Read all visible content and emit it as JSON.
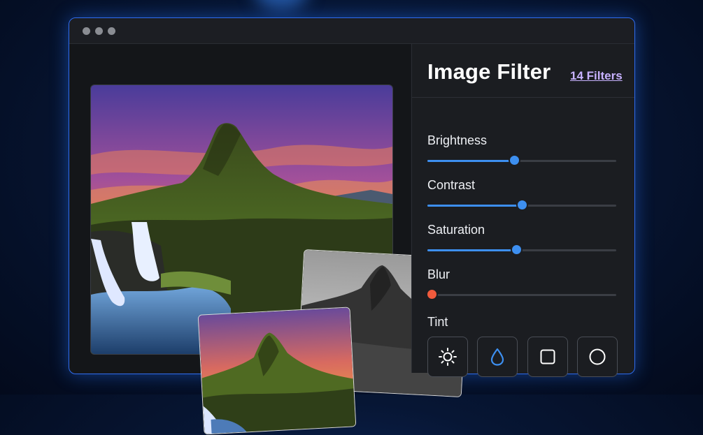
{
  "panel": {
    "title": "Image Filter",
    "filters_link": "14 Filters"
  },
  "sliders": [
    {
      "label": "Brightness",
      "value": 0.46
    },
    {
      "label": "Contrast",
      "value": 0.5
    },
    {
      "label": "Saturation",
      "value": 0.47
    },
    {
      "label": "Blur",
      "value": 0.0
    }
  ],
  "tint": {
    "label": "Tint",
    "buttons": [
      {
        "icon": "sun-icon"
      },
      {
        "icon": "droplet-icon"
      },
      {
        "icon": "square-icon"
      },
      {
        "icon": "circle-icon"
      }
    ]
  },
  "colors": {
    "accent": "#3d8ff0",
    "blur_thumb": "#f05a3c",
    "link": "#c8b2ff"
  }
}
